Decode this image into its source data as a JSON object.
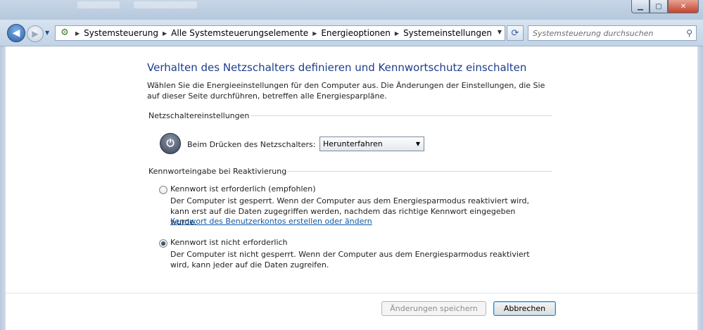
{
  "window": {
    "minimize_glyph": "▁",
    "maximize_glyph": "▢",
    "close_glyph": "✕"
  },
  "nav": {
    "back_glyph": "◀",
    "forward_glyph": "▶",
    "history_glyph": "▼"
  },
  "address": {
    "icon": "control-panel-icon",
    "breadcrumbs": [
      "Systemsteuerung",
      "Alle Systemsteuerungselemente",
      "Energieoptionen",
      "Systemeinstellungen"
    ],
    "dropdown_glyph": "▼",
    "refresh_glyph": "⟳"
  },
  "search": {
    "placeholder": "Systemsteuerung durchsuchen",
    "icon": "search-icon"
  },
  "page": {
    "title": "Verhalten des Netzschalters definieren und Kennwortschutz einschalten",
    "intro": "Wählen Sie die Energieeinstellungen für den Computer aus. Die Änderungen der Einstellungen, die Sie auf dieser Seite durchführen, betreffen alle Energiesparpläne."
  },
  "power_section": {
    "heading": "Netzschaltereinstellungen",
    "label": "Beim Drücken des Netzschalters:",
    "selected": "Herunterfahren"
  },
  "password_section": {
    "heading": "Kennworteingabe bei Reaktivierung",
    "options": [
      {
        "title": "Kennwort ist erforderlich (empfohlen)",
        "description": "Der Computer ist gesperrt. Wenn der Computer aus dem Energiesparmodus reaktiviert wird, kann erst auf die Daten zugegriffen werden, nachdem das richtige Kennwort eingegeben wurde.",
        "link": "Kennwort des Benutzerkontos erstellen oder ändern",
        "checked": false
      },
      {
        "title": "Kennwort ist nicht erforderlich",
        "description": "Der Computer ist nicht gesperrt. Wenn der Computer aus dem Energiesparmodus reaktiviert wird, kann jeder auf die Daten zugreifen.",
        "checked": true
      }
    ]
  },
  "footer": {
    "save_label": "Änderungen speichern",
    "cancel_label": "Abbrechen"
  },
  "colors": {
    "title_blue": "#1e3d8c",
    "link_blue": "#0f5aa8"
  }
}
